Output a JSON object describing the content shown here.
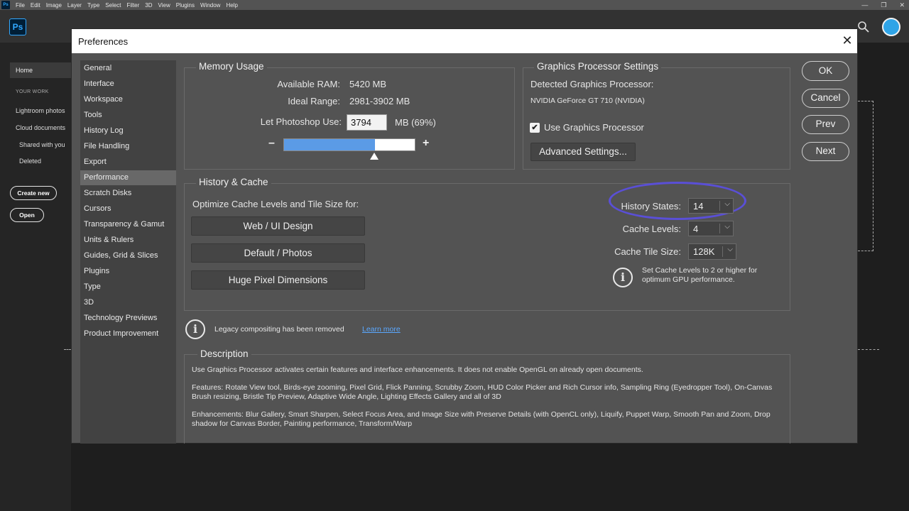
{
  "app": {
    "menu": [
      "File",
      "Edit",
      "Image",
      "Layer",
      "Type",
      "Select",
      "Filter",
      "3D",
      "View",
      "Plugins",
      "Window",
      "Help"
    ],
    "logo_text": "Ps",
    "window_controls": [
      "—",
      "❐",
      "✕"
    ]
  },
  "home_sidebar": {
    "home": "Home",
    "your_work": "YOUR WORK",
    "items": [
      "Lightroom photos",
      "Cloud documents",
      "Shared with you",
      "Deleted"
    ],
    "create_new": "Create new",
    "open": "Open"
  },
  "dialog": {
    "title": "Preferences",
    "close": "✕",
    "categories": [
      "General",
      "Interface",
      "Workspace",
      "Tools",
      "History Log",
      "File Handling",
      "Export",
      "Performance",
      "Scratch Disks",
      "Cursors",
      "Transparency & Gamut",
      "Units & Rulers",
      "Guides, Grid & Slices",
      "Plugins",
      "Type",
      "3D",
      "Technology Previews",
      "Product Improvement"
    ],
    "active_category": "Performance",
    "memory": {
      "legend": "Memory Usage",
      "available_label": "Available RAM:",
      "available_value": "5420 MB",
      "ideal_label": "Ideal Range:",
      "ideal_value": "2981-3902 MB",
      "let_label": "Let Photoshop Use:",
      "let_value": "3794",
      "let_unit": "MB (69%)",
      "slider_fraction": 0.69,
      "minus": "–",
      "plus": "+"
    },
    "gpu": {
      "legend": "Graphics Processor Settings",
      "detected_label": "Detected Graphics Processor:",
      "detected_value": "NVIDIA GeForce GT 710 (NVIDIA)",
      "use_gpu_label": "Use Graphics Processor",
      "use_gpu_checked": "✔",
      "advanced_button": "Advanced Settings..."
    },
    "buttons": {
      "ok": "OK",
      "cancel": "Cancel",
      "prev": "Prev",
      "next": "Next"
    },
    "history_cache": {
      "legend": "History & Cache",
      "optimize_label": "Optimize Cache Levels and Tile Size for:",
      "presets": [
        "Web / UI Design",
        "Default / Photos",
        "Huge Pixel Dimensions"
      ],
      "history_states_label": "History States:",
      "history_states_value": "14",
      "cache_levels_label": "Cache Levels:",
      "cache_levels_value": "4",
      "cache_tile_label": "Cache Tile Size:",
      "cache_tile_value": "128K",
      "info_text": "Set Cache Levels to 2 or higher for optimum GPU performance."
    },
    "legacy": {
      "text": "Legacy compositing has been removed",
      "link": "Learn more"
    },
    "description": {
      "legend": "Description",
      "p1": "Use Graphics Processor activates certain features and interface enhancements. It does not enable OpenGL on already open documents.",
      "p2": "Features: Rotate View tool, Birds-eye zooming, Pixel Grid, Flick Panning, Scrubby Zoom, HUD Color Picker and Rich Cursor info, Sampling Ring (Eyedropper Tool), On-Canvas Brush resizing, Bristle Tip Preview, Adaptive Wide Angle, Lighting Effects Gallery and all of 3D",
      "p3": "Enhancements: Blur Gallery, Smart Sharpen, Select Focus Area, and Image Size with Preserve Details (with OpenCL only), Liquify, Puppet Warp, Smooth Pan and Zoom, Drop shadow for Canvas Border, Painting performance, Transform/Warp"
    }
  },
  "colors": {
    "highlight_oval": "#5a4fd6",
    "slider_fill": "#5b9be6",
    "link": "#5aa8ff"
  }
}
